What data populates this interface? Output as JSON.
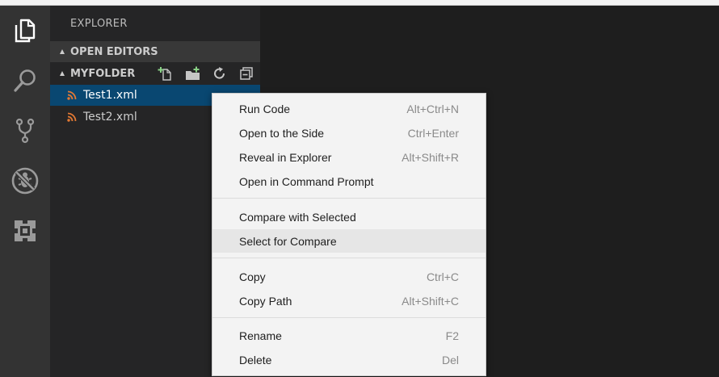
{
  "activity_bar": {
    "items": [
      "files-icon",
      "search-icon",
      "source-control-icon",
      "debug-icon",
      "extensions-icon"
    ]
  },
  "sidebar": {
    "title": "EXPLORER",
    "sections": {
      "open_editors": "OPEN EDITORS",
      "folder": "MYFOLDER"
    },
    "folder_actions": [
      "new-file-icon",
      "new-folder-icon",
      "refresh-icon",
      "collapse-all-icon"
    ],
    "files": [
      {
        "name": "Test1.xml",
        "icon": "rss-icon",
        "selected": true
      },
      {
        "name": "Test2.xml",
        "icon": "rss-icon",
        "selected": false
      }
    ]
  },
  "context_menu": {
    "groups": [
      [
        {
          "label": "Run Code",
          "shortcut": "Alt+Ctrl+N"
        },
        {
          "label": "Open to the Side",
          "shortcut": "Ctrl+Enter"
        },
        {
          "label": "Reveal in Explorer",
          "shortcut": "Alt+Shift+R"
        },
        {
          "label": "Open in Command Prompt",
          "shortcut": ""
        }
      ],
      [
        {
          "label": "Compare with Selected",
          "shortcut": ""
        },
        {
          "label": "Select for Compare",
          "shortcut": "",
          "highlighted": true
        }
      ],
      [
        {
          "label": "Copy",
          "shortcut": "Ctrl+C"
        },
        {
          "label": "Copy Path",
          "shortcut": "Alt+Shift+C"
        }
      ],
      [
        {
          "label": "Rename",
          "shortcut": "F2"
        },
        {
          "label": "Delete",
          "shortcut": "Del"
        }
      ]
    ]
  },
  "colors": {
    "activity_bar": "#333333",
    "sidebar": "#252526",
    "editor": "#1e1e1e",
    "selection": "#094771",
    "file_icon": "#e37933",
    "menu_bg": "#f3f3f3"
  }
}
